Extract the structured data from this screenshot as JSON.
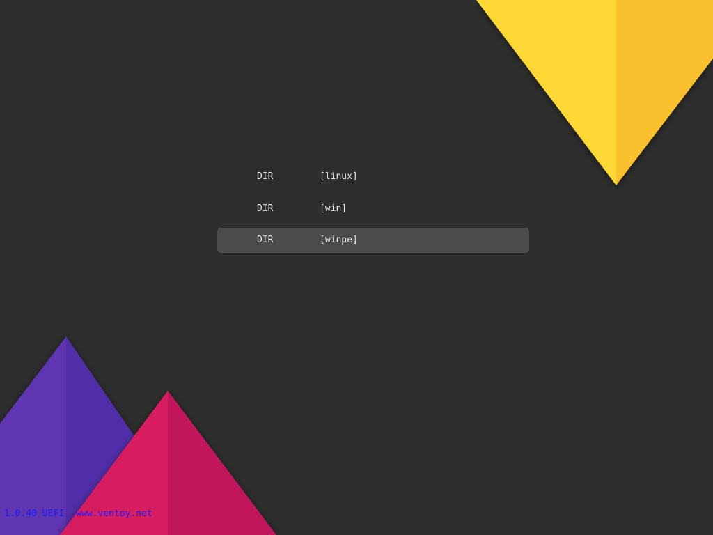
{
  "theme": {
    "background": "#2d2d2d",
    "selection": "#4b4b4b",
    "text": "#e6e6e6",
    "footer_text": "#1a1aff",
    "yellow_light": "#fdd835",
    "yellow_dark": "#fbc02d",
    "purple_light": "#5e35b1",
    "purple_dark": "#512da8",
    "pink_light": "#d81b60",
    "pink_dark": "#c2185b"
  },
  "menu": {
    "selected_index": 2,
    "items": [
      {
        "type": "DIR",
        "name": "[linux]"
      },
      {
        "type": "DIR",
        "name": "[win]"
      },
      {
        "type": "DIR",
        "name": "[winpe]"
      }
    ]
  },
  "footer": {
    "version": "1.0.40 UEFI",
    "website": "www.ventoy.net"
  }
}
